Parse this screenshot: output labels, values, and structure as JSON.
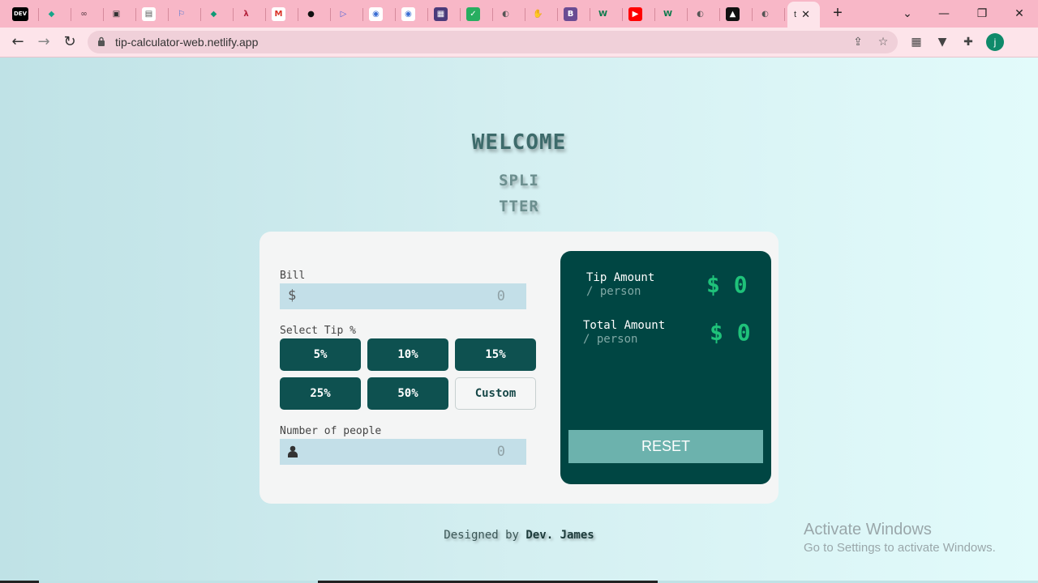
{
  "browser": {
    "tabs": [
      {
        "icon": "dev-icon",
        "text": "DEV",
        "color": "#000000",
        "fg": "#ffffff"
      },
      {
        "icon": "diamond-icon",
        "text": "◆",
        "color": "#f8b7c7",
        "fg": "#17a589"
      },
      {
        "icon": "glasses-icon",
        "text": "∞",
        "color": "#f8b7c7",
        "fg": "#7a5560"
      },
      {
        "icon": "camera-icon",
        "text": "▣",
        "color": "#f8b7c7",
        "fg": "#333333"
      },
      {
        "icon": "page-icon",
        "text": "▤",
        "color": "#ffffff",
        "fg": "#555555"
      },
      {
        "icon": "flag-icon",
        "text": "⚐",
        "color": "#f8b7c7",
        "fg": "#3b6fd4"
      },
      {
        "icon": "diamond-icon",
        "text": "◆",
        "color": "#f8b7c7",
        "fg": "#0f9a76"
      },
      {
        "icon": "scribble-icon",
        "text": "λ",
        "color": "#f8b7c7",
        "fg": "#b21f3a"
      },
      {
        "icon": "gmail-icon",
        "text": "M",
        "color": "#ffffff",
        "fg": "#d93025"
      },
      {
        "icon": "github-icon",
        "text": "●",
        "color": "#f8b7c7",
        "fg": "#111111"
      },
      {
        "icon": "play-icon",
        "text": "▷",
        "color": "#f8b7c7",
        "fg": "#4c5fd6"
      },
      {
        "icon": "circle-dot-icon",
        "text": "◉",
        "color": "#ffffff",
        "fg": "#3b6fd4"
      },
      {
        "icon": "circle-dot-icon",
        "text": "◉",
        "color": "#ffffff",
        "fg": "#3b6fd4"
      },
      {
        "icon": "coolors-icon",
        "text": "▦",
        "color": "#4a3b7a",
        "fg": "#ffffff"
      },
      {
        "icon": "check-icon",
        "text": "✓",
        "color": "#27ae60",
        "fg": "#ffffff"
      },
      {
        "icon": "globe-icon",
        "text": "◐",
        "color": "#f8b7c7",
        "fg": "#555555"
      },
      {
        "icon": "hand-icon",
        "text": "✋",
        "color": "#f8b7c7",
        "fg": "#e07a2e"
      },
      {
        "icon": "b-icon",
        "text": "B",
        "color": "#6a4c93",
        "fg": "#ffffff"
      },
      {
        "icon": "w-icon",
        "text": "W",
        "color": "#f8b7c7",
        "fg": "#0b7a4b"
      },
      {
        "icon": "youtube-icon",
        "text": "▶",
        "color": "#ff0000",
        "fg": "#ffffff"
      },
      {
        "icon": "w-icon",
        "text": "W",
        "color": "#f8b7c7",
        "fg": "#0b7a4b"
      },
      {
        "icon": "globe-icon",
        "text": "◐",
        "color": "#f8b7c7",
        "fg": "#555555"
      },
      {
        "icon": "triangle-circle-icon",
        "text": "▲",
        "color": "#111111",
        "fg": "#ffffff"
      },
      {
        "icon": "globe-icon",
        "text": "◐",
        "color": "#f8b7c7",
        "fg": "#555555"
      }
    ],
    "active_tab": {
      "label": "t",
      "close": "✕"
    },
    "new_tab": "+",
    "window": {
      "dropdown": "⌄",
      "minimize": "—",
      "restore": "❐",
      "close": "✕"
    },
    "nav": {
      "back": "←",
      "forward": "→",
      "reload": "↻"
    },
    "url": "tip-calculator-web.netlify.app",
    "profile_initial": "j"
  },
  "app": {
    "welcome": "WELCOME",
    "logo_line1": "SPLI",
    "logo_line2": "TTER",
    "bill_label": "Bill",
    "bill_prefix": "$",
    "bill_value": "0",
    "tip_label": "Select Tip %",
    "tips": [
      "5%",
      "10%",
      "15%",
      "25%",
      "50%"
    ],
    "custom_label": "Custom",
    "people_label": "Number of people",
    "people_value": "0",
    "tip_amount_title": "Tip Amount",
    "tip_amount_sub": "/ person",
    "tip_amount_value": "$ 0",
    "total_amount_title": "Total Amount",
    "total_amount_sub": "/ person",
    "total_amount_value": "$ 0",
    "reset_label": "RESET",
    "footer_prefix": "Designed by",
    "footer_author": "Dev. James"
  },
  "watermark": {
    "line1": "Activate Windows",
    "line2": "Go to Settings to activate Windows."
  }
}
